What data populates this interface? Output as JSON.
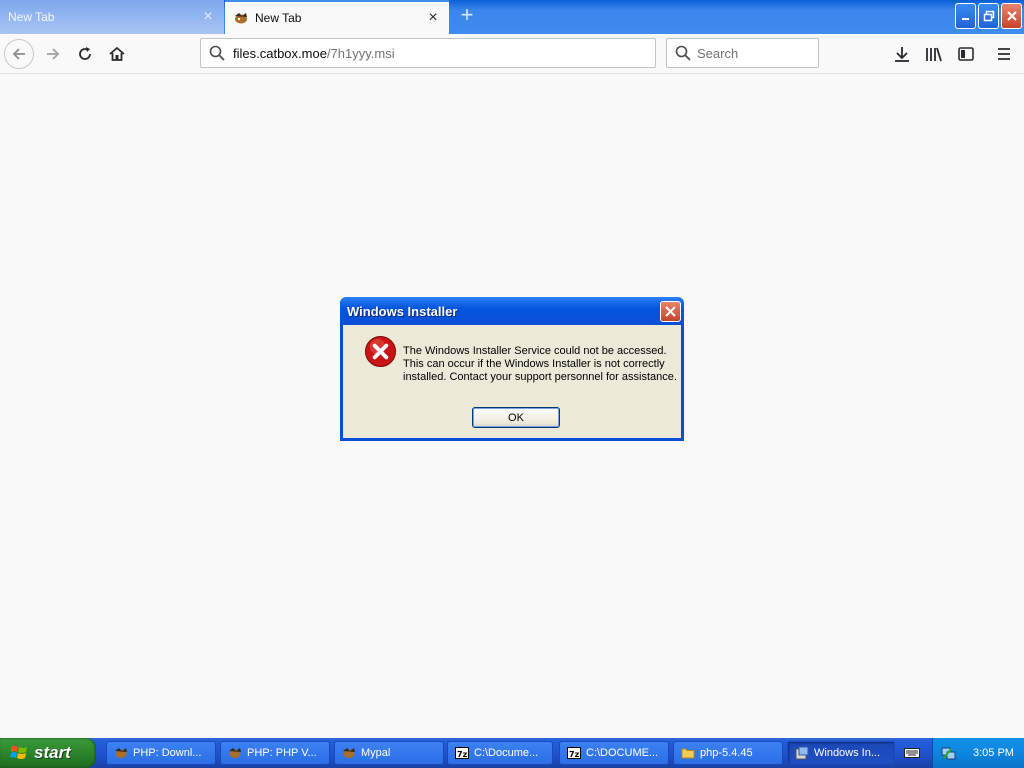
{
  "browser": {
    "tabs": [
      {
        "label": "New Tab",
        "state": "inactive"
      },
      {
        "label": "New Tab",
        "state": "active"
      }
    ],
    "new_tab_icon": "plus-icon",
    "url_host": "files.catbox.moe",
    "url_path": "/7h1yyy.msi",
    "search_placeholder": "Search",
    "toolbar_icons": [
      "back-arrow-icon",
      "forward-arrow-icon",
      "reload-icon",
      "home-icon",
      "download-icon",
      "library-icon",
      "sidebar-icon",
      "menu-icon"
    ]
  },
  "dialog": {
    "title": "Windows Installer",
    "message_lines": [
      "The Windows Installer Service could not be accessed.",
      "This can occur if the Windows Installer is not correctly",
      "installed. Contact your support personnel for assistance."
    ],
    "ok_label": "OK",
    "icon": "error-icon"
  },
  "taskbar": {
    "start_label": "start",
    "tasks": [
      {
        "label": "PHP: Downl...",
        "icon": "firefox-icon",
        "active": false
      },
      {
        "label": "PHP: PHP V...",
        "icon": "firefox-icon",
        "active": false
      },
      {
        "label": "Mypal",
        "icon": "firefox-icon",
        "active": false
      },
      {
        "label": "C:\\Docume...",
        "icon": "7zip-icon",
        "active": false
      },
      {
        "label": "C:\\DOCUME...",
        "icon": "7zip-icon",
        "active": false
      },
      {
        "label": "php-5.4.45",
        "icon": "folder-icon",
        "active": false
      },
      {
        "label": "Windows In...",
        "icon": "installer-icon",
        "active": true
      }
    ],
    "clock": "3:05 PM"
  },
  "colors": {
    "xp_blue": "#0a4ed4",
    "dialog_face": "#ece9d8",
    "start_green": "#2f8a2e",
    "tray_blue": "#0e86df"
  }
}
